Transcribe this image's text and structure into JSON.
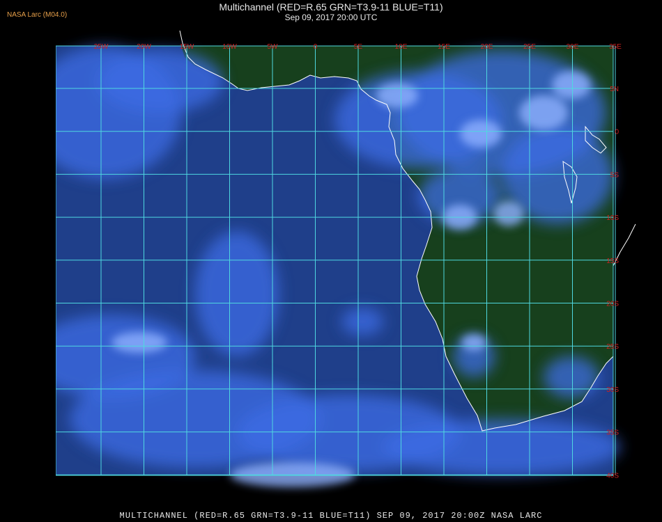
{
  "header": {
    "source": "NASA Larc (M04.0)",
    "title": "Multichannel (RED=R.65 GRN=T3.9-11 BLUE=T11)",
    "subtitle": "Sep 09, 2017 20:00 UTC"
  },
  "footer": {
    "caption": "MULTICHANNEL (RED=R.65 GRN=T3.9-11 BLUE=T11) SEP 09, 2017 20:00Z  NASA LARC"
  },
  "map": {
    "longitude_labels": [
      "25W",
      "20W",
      "15W",
      "10W",
      "5W",
      "0",
      "5E",
      "10E",
      "15E",
      "20E",
      "25E",
      "30E",
      "35E"
    ],
    "latitude_labels": [
      "5N",
      "0",
      "5S",
      "10S",
      "15S",
      "20S",
      "25S",
      "30S",
      "35S",
      "40S"
    ],
    "colors": {
      "background": "#000000",
      "land": "#17401d",
      "ocean": "#1f3f8a",
      "cloud": "#3d6ee6",
      "bright_cloud": "#8fb2ff",
      "grid": "#4fd8e0",
      "coastline": "#ffffff",
      "grid_label": "#d02020"
    }
  }
}
